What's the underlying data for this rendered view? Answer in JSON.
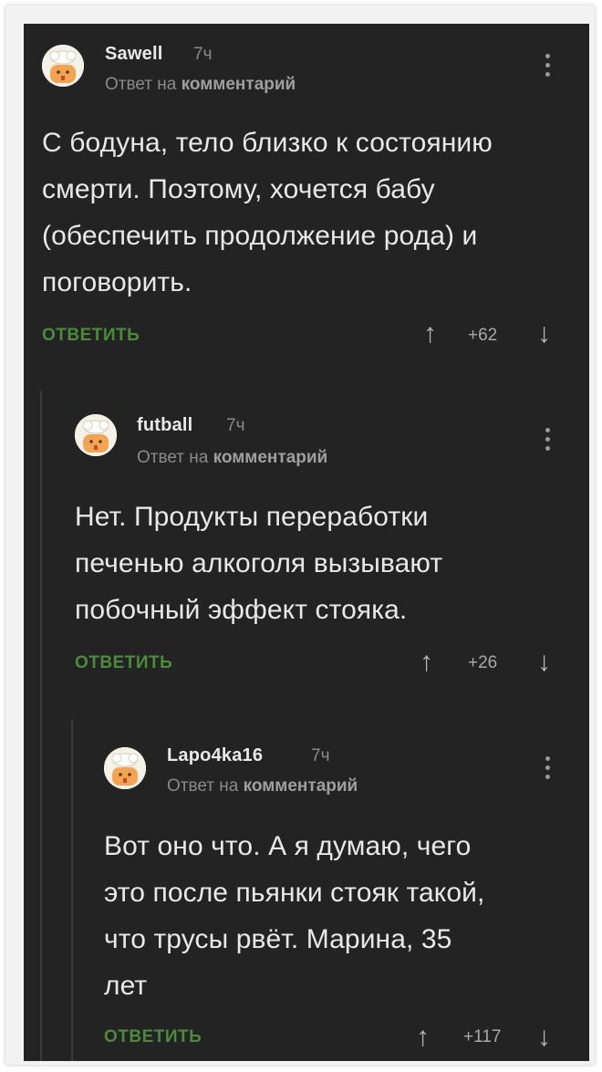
{
  "colors": {
    "background": "#232324",
    "text": "#e8e8e8",
    "muted": "#8a8a8a",
    "reply_button": "#4d8a3c"
  },
  "comments": [
    {
      "username": "Sawell",
      "time": "7ч",
      "reply_to_prefix": "Ответ на",
      "reply_to_target": "комментарий",
      "lines": [
        "С бодуна, тело близко к состоянию",
        "смерти. Поэтому, хочется бабу",
        "(обеспечить продолжение рода) и",
        "поговорить."
      ],
      "reply_label": "ОТВЕТИТЬ",
      "rating": "+62",
      "upvote_icon": "arrow-up-icon",
      "downvote_icon": "arrow-down-icon"
    },
    {
      "username": "futball",
      "time": "7ч",
      "reply_to_prefix": "Ответ на",
      "reply_to_target": "комментарий",
      "lines": [
        "Нет. Продукты переработки",
        "печенью алкоголя вызывают",
        "побочный эффект стояка."
      ],
      "reply_label": "ОТВЕТИТЬ",
      "rating": "+26",
      "upvote_icon": "arrow-up-icon",
      "downvote_icon": "arrow-down-icon"
    },
    {
      "username": "Lapo4ka16",
      "time": "7ч",
      "reply_to_prefix": "Ответ на",
      "reply_to_target": "комментарий",
      "lines": [
        "Вот оно что. А я думаю, чего",
        "это после пьянки стояк такой,",
        "что трусы рвёт. Марина, 35",
        "лет"
      ],
      "reply_label": "ОТВЕТИТЬ",
      "rating": "+117",
      "upvote_icon": "arrow-up-icon",
      "downvote_icon": "arrow-down-icon"
    }
  ]
}
